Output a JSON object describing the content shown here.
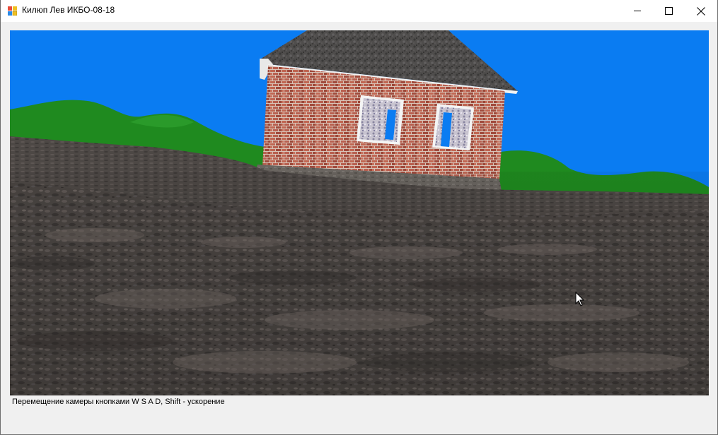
{
  "window": {
    "title": "Килюп Лев ИКБО-08-18"
  },
  "titlebar_buttons": {
    "minimize_icon": "minimize-icon",
    "maximize_icon": "maximize-icon",
    "close_icon": "close-icon"
  },
  "scene": {
    "sky_color": "#0a7cf2",
    "hill_color": "#1f8a1f",
    "ground_color": "#4a4542",
    "brick_color": "#b0584a",
    "roof_color": "#4d4b4a"
  },
  "status": {
    "hint": "Перемещение камеры кнопками W S A D, Shift - ускорение"
  }
}
